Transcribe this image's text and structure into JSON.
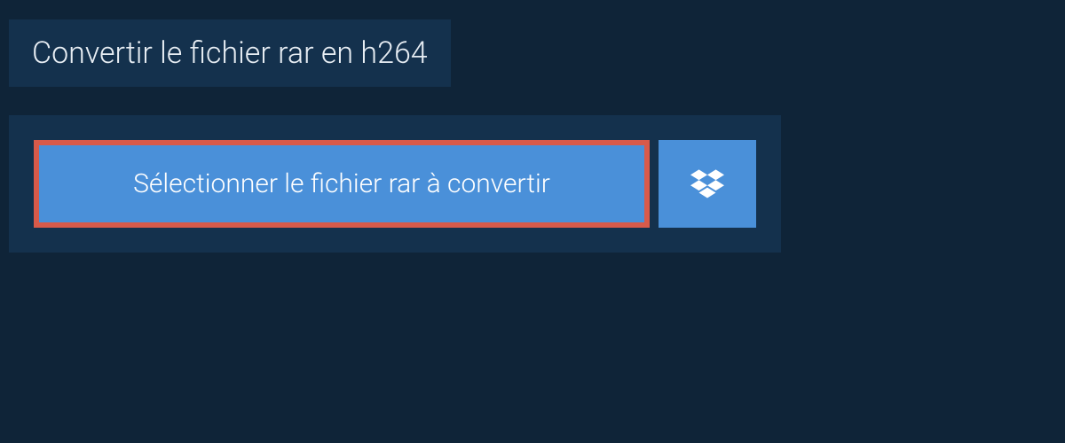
{
  "header": {
    "title": "Convertir le fichier rar en h264"
  },
  "buttons": {
    "select_label": "Sélectionner le fichier rar à convertir"
  },
  "colors": {
    "page_bg": "#0f2438",
    "panel_bg": "#14314d",
    "button_bg": "#4a90d9",
    "highlight_border": "#d85a4a",
    "text_light": "#e8eef4",
    "text_white": "#ffffff"
  }
}
